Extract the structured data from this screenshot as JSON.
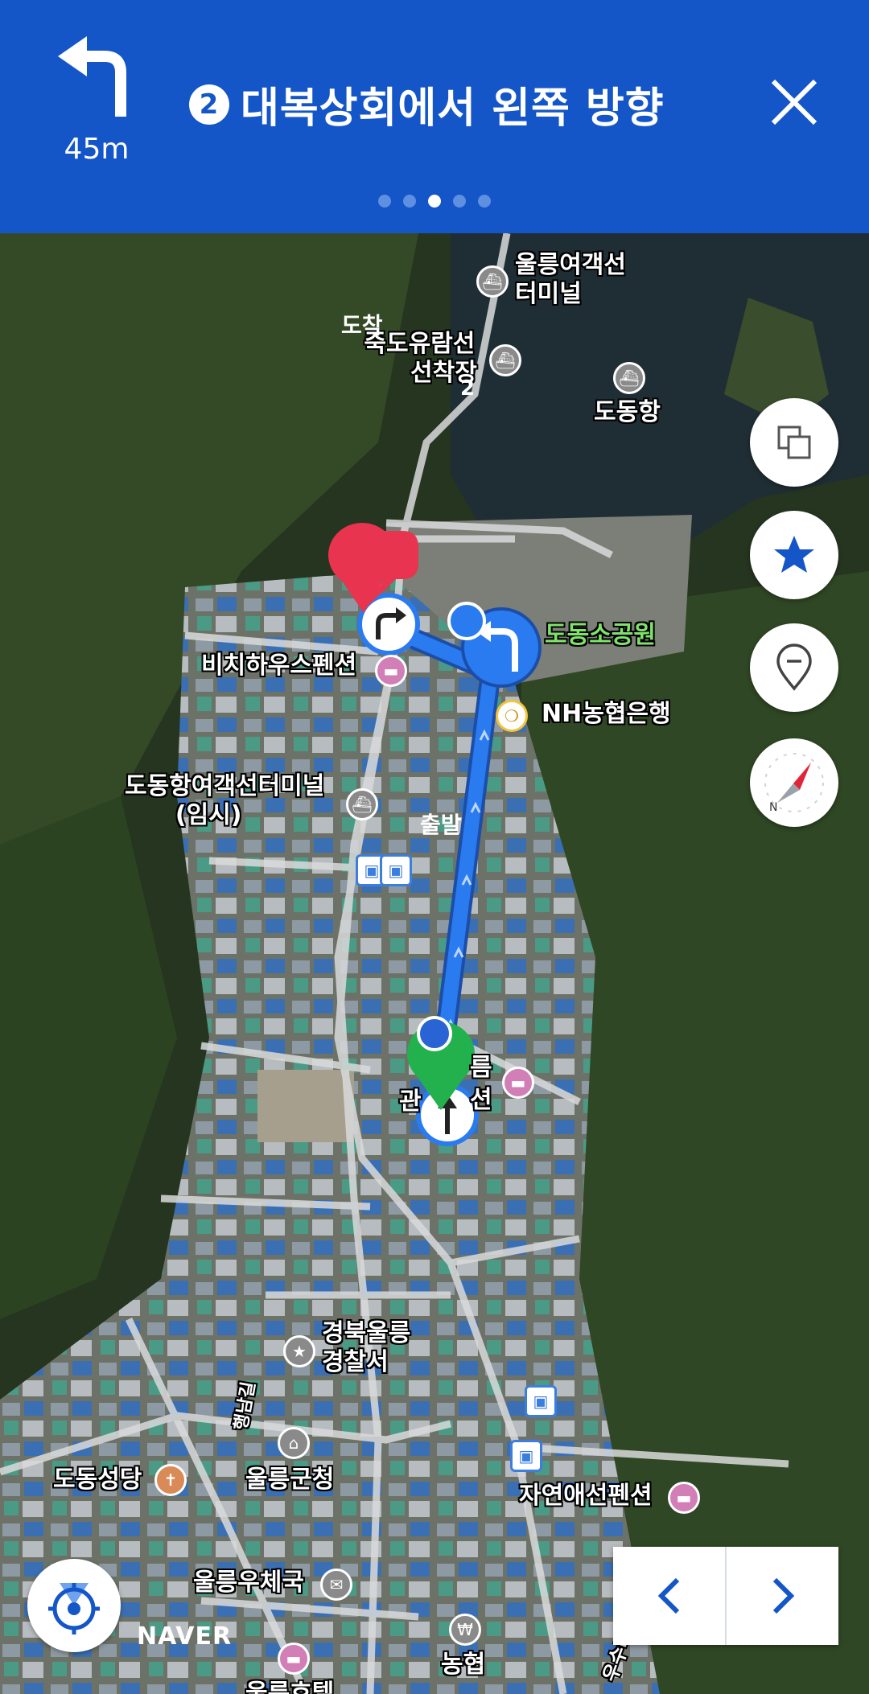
{
  "header": {
    "distance": "45m",
    "step_number": "2",
    "instruction": "대복상회에서 왼쪽 방향",
    "page_dots": 5,
    "active_dot": 3
  },
  "map": {
    "labels": {
      "ferry_terminal_1": "울릉여객선",
      "ferry_terminal_2": "터미널",
      "jukdo_1": "죽도유람선",
      "jukdo_2": "선착장",
      "dodong_port": "도동항",
      "park": "도동소공원",
      "nh_bank": "NH농협은행",
      "pension_bichi": "비치하우스펜션",
      "temp_terminal_1": "도동항여객선터미널",
      "temp_terminal_2": "(임시)",
      "pension_hidden_1": "름",
      "pension_hidden_2": "관",
      "pension_hidden_3": "션",
      "police_1": "경북울릉",
      "police_2": "경찰서",
      "road_name": "행남길",
      "church": "도동성당",
      "county_office": "울릉군청",
      "pension_nature": "자연애선펜션",
      "post_office": "울릉우체국",
      "nonghyup": "농협",
      "hotel": "울릉호텔",
      "road_bottom": "우수티길"
    },
    "markers": {
      "arrival": "도착",
      "departure": "출발",
      "route_step": "2"
    }
  },
  "controls": {
    "layers_icon": "layers-icon",
    "favorite_icon": "star-icon",
    "pin_icon": "location-pin-icon",
    "compass_icon": "compass-icon",
    "compass_letter": "N"
  },
  "footer": {
    "brand": "NAVER"
  },
  "colors": {
    "header_bg": "#1456c8",
    "route": "#2a7bf0",
    "arrival": "#e8344e",
    "departure": "#23b14d"
  }
}
